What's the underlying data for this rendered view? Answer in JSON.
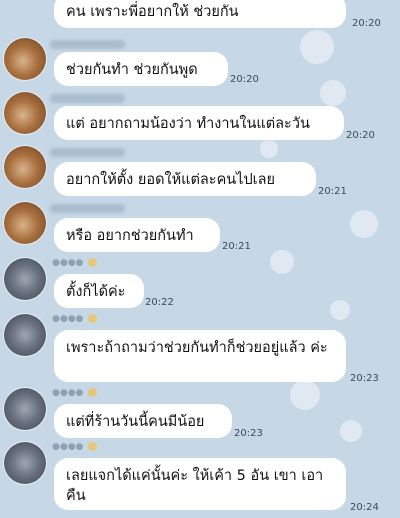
{
  "colors": {
    "background": "#c6d8e6",
    "bubble": "#ffffff",
    "time_text": "#3d4a59"
  },
  "messages": [
    {
      "text": "คน เพราะพี่อยากให้ ช่วยกัน",
      "time": "20:20",
      "avatar": false
    },
    {
      "text": "ช่วยกันทำ ช่วยกันพูด",
      "time": "20:20",
      "avatar": "brown-avatar"
    },
    {
      "text": "แต่ อยากถามน้องว่า ทำงานในแต่ละวัน",
      "time": "20:20",
      "avatar": "brown-avatar"
    },
    {
      "text": "อยากให้ตั้ง ยอดให้แต่ละคนไปเลย",
      "time": "20:21",
      "avatar": "brown-avatar"
    },
    {
      "text": "หรือ อยากช่วยกันทำ",
      "time": "20:21",
      "avatar": "brown-avatar"
    },
    {
      "text": "ตั้งก็ได้ค่ะ",
      "time": "20:22",
      "avatar": "gray-avatar"
    },
    {
      "text": "เพราะถ้าถามว่าช่วยกันทำก็ช่วยอยู่แล้ว ค่ะ",
      "time": "20:23",
      "avatar": "gray-avatar"
    },
    {
      "text": "แต่ที่ร้านวันนี้คนมีน้อย",
      "time": "20:23",
      "avatar": "gray-avatar"
    },
    {
      "text": "เลยแจกได้แค่นั้นค่ะ ให้เค้า 5 อัน เขา เอาคืน",
      "time": "20:24",
      "avatar": "gray-avatar"
    }
  ]
}
